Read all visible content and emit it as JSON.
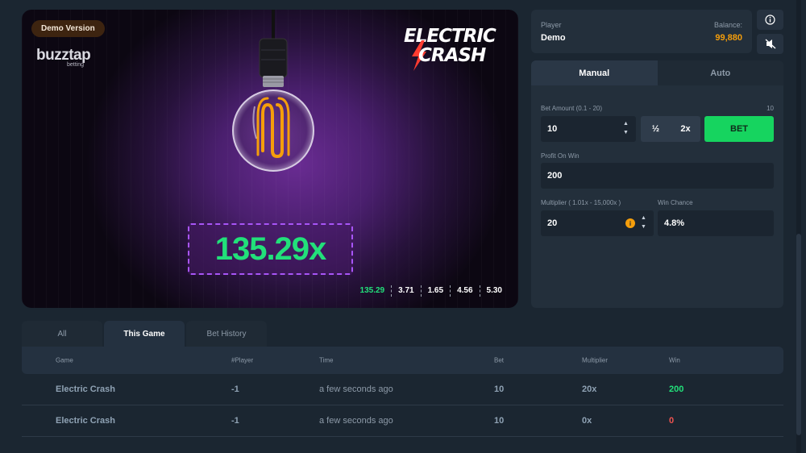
{
  "game": {
    "demo_badge": "Demo Version",
    "brand_name": "buzztap",
    "brand_sub": "betting",
    "logo_line1": "ELECTRIC",
    "logo_line2": "CRASH",
    "multiplier": "135.29x",
    "recent_multipliers": [
      "135.29",
      "3.71",
      "1.65",
      "4.56",
      "5.30"
    ]
  },
  "player": {
    "label": "Player",
    "name": "Demo",
    "balance_label": "Balance:",
    "balance": "99,880"
  },
  "icons": {
    "info": "info-icon",
    "sound": "sound-muted-icon"
  },
  "bet_panel": {
    "tabs": [
      "Manual",
      "Auto"
    ],
    "active_tab": "Manual",
    "bet_amount_label": "Bet Amount (0.1 - 20)",
    "bet_amount_max": "10",
    "bet_amount": "10",
    "half_label": "½",
    "double_label": "2x",
    "bet_button": "BET",
    "profit_label": "Profit On Win",
    "profit_value": "200",
    "multiplier_label": "Multiplier ( 1.01x - 15,000x )",
    "multiplier_value": "20",
    "win_chance_label": "Win Chance",
    "win_chance_value": "4.8%"
  },
  "history": {
    "tabs": [
      "All",
      "This Game",
      "Bet History"
    ],
    "active_tab": "This Game",
    "columns": [
      "Game",
      "#Player",
      "Time",
      "Bet",
      "Multiplier",
      "Win"
    ],
    "rows": [
      {
        "game": "Electric Crash",
        "player": "-1",
        "time": "a few seconds ago",
        "bet": "10",
        "multiplier": "20x",
        "win": "200"
      },
      {
        "game": "Electric Crash",
        "player": "-1",
        "time": "a few seconds ago",
        "bet": "10",
        "multiplier": "0x",
        "win": "0"
      }
    ]
  },
  "colors": {
    "accent_green": "#22e07a",
    "bet_button": "#16d45f",
    "balance": "#f59e0b",
    "loss": "#ef5350",
    "panel": "#232f3b",
    "background": "#1b2631"
  }
}
